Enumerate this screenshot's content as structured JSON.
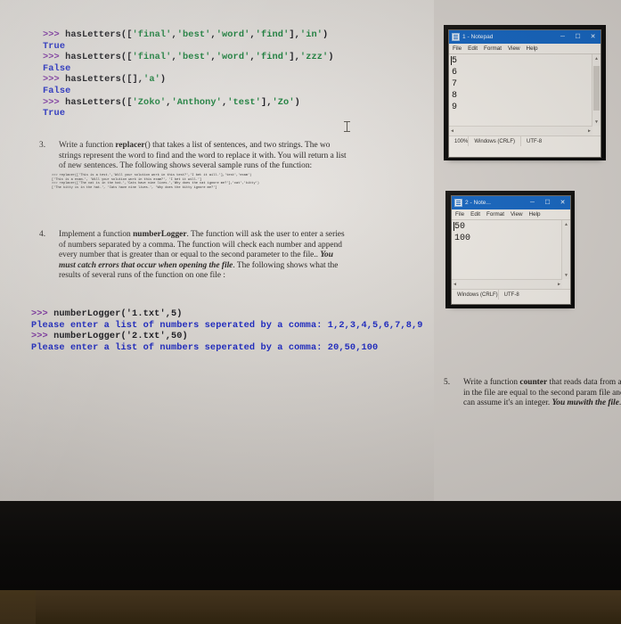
{
  "screen": {
    "console_top": {
      "lines": [
        {
          "prompt": ">>> ",
          "call": "hasLetters(['final','best','word','find'],'in')"
        },
        {
          "result": "True"
        },
        {
          "prompt": ">>> ",
          "call": "hasLetters(['final','best','word','find'],'zzz')"
        },
        {
          "result": "False"
        },
        {
          "prompt": ">>> ",
          "call": "hasLetters([],'a')"
        },
        {
          "result": "False"
        },
        {
          "prompt": ">>> ",
          "call": "hasLetters(['Zoko','Anthony','test'],'Zo')"
        },
        {
          "result": "True"
        }
      ],
      "l1_prompt": ">>> ",
      "l1_fn": "hasLetters",
      "l1_open": "([",
      "l1_s1": "'final'",
      "l1_s2": "'best'",
      "l1_s3": "'word'",
      "l1_s4": "'find'",
      "l1_close": "],",
      "l1_s5": "'in'",
      "l1_end": ")",
      "l2_val": "True",
      "l3_s5": "'zzz'",
      "l4_val": "False",
      "l5_open": "([],",
      "l5_s1": "'a'",
      "l5_end": ")",
      "l6_val": "False",
      "l7_s1": "'Zoko'",
      "l7_s2": "'Anthony'",
      "l7_s3": "'test'",
      "l7_s5": "'Zo'",
      "l8_val": "True",
      "comma": ",",
      "fn_name": "hasLetters"
    },
    "console_mid": {
      "l1_prompt": ">>> ",
      "l1_fn": "numberLogger",
      "l1_args": "('1.txt',5)",
      "l2_out": "Please enter a list of numbers seperated by a comma: 1,2,3,4,5,6,7,8,9",
      "l3_prompt": ">>> ",
      "l3_fn": "numberLogger",
      "l3_args": "('2.txt',50)",
      "l4_out": "Please enter a list of numbers seperated by a comma: 20,50,100"
    },
    "questions": {
      "q3": {
        "number": "3.",
        "part1": "Write a function ",
        "bold": "replacer",
        "part2": "() that takes a list of sentences, and two strings.  The wo strings represent the word to find and the word to replace it with. You will return a list of new sentences. The following shows several sample runs of the function:",
        "sample": ">>> replacer(['This is a test.','Will your solution work in this test?','I bet it will.'],'test','exam')\n['This is a exam.', 'Will your solution work in this exam?', 'I bet it will.']\n>>> replacer(['The cat is in the hat.','Cats have nine lives.','Why does the cat ignore me?'],'cat','kitty')\n['The kitty is in the hat.', 'Cats have nine lives.', 'Why does the kitty ignore me?']"
      },
      "q4": {
        "number": "4.",
        "part1": "Implement a function ",
        "bold": "numberLogger",
        "part2": ". The function will ask the user to enter a series of numbers separated by a comma.  The function will check each number and append every number that is greater than or equal to the second parameter to the file.. ",
        "bolditalic": "You must catch errors that occur when opening the file",
        "part3": ". The following shows what the results of several runs of the function on one file :"
      },
      "q5": {
        "number": "5.",
        "part1": "Write a function ",
        "bold": "counter",
        "part2": " that reads data from a values in the file are equal to the second param file and you can assume it's an integer. ",
        "bolditalic1": "You mu",
        "bolditalic2": "with the file",
        "part3": "."
      }
    },
    "notepad1": {
      "title": "1 - Notepad",
      "menu": [
        "File",
        "Edit",
        "Format",
        "View",
        "Help"
      ],
      "lines": [
        "5",
        "6",
        "7",
        "8",
        "9"
      ],
      "status": [
        "100%",
        "Windows (CRLF)",
        "UTF-8"
      ],
      "minimize": "─",
      "maximize": "☐",
      "close": "✕",
      "scroll_up": "▲",
      "scroll_down": "▼",
      "scroll_left": "◀",
      "scroll_right": "▶"
    },
    "notepad2": {
      "title": "2 - Note...",
      "menu": [
        "File",
        "Edit",
        "Format",
        "View",
        "Help"
      ],
      "lines": [
        "50",
        "100"
      ],
      "status": [
        "Windows (CRLF)",
        "UTF-8"
      ],
      "minimize": "─",
      "maximize": "☐",
      "close": "✕",
      "scroll_up": "▲",
      "scroll_down": "▼",
      "scroll_left": "◀",
      "scroll_right": "▶"
    }
  },
  "colors": {
    "prompt": "#7b2fa0",
    "string": "#1f8440",
    "output": "#1c28c4",
    "titlebar": "#1565c0"
  }
}
